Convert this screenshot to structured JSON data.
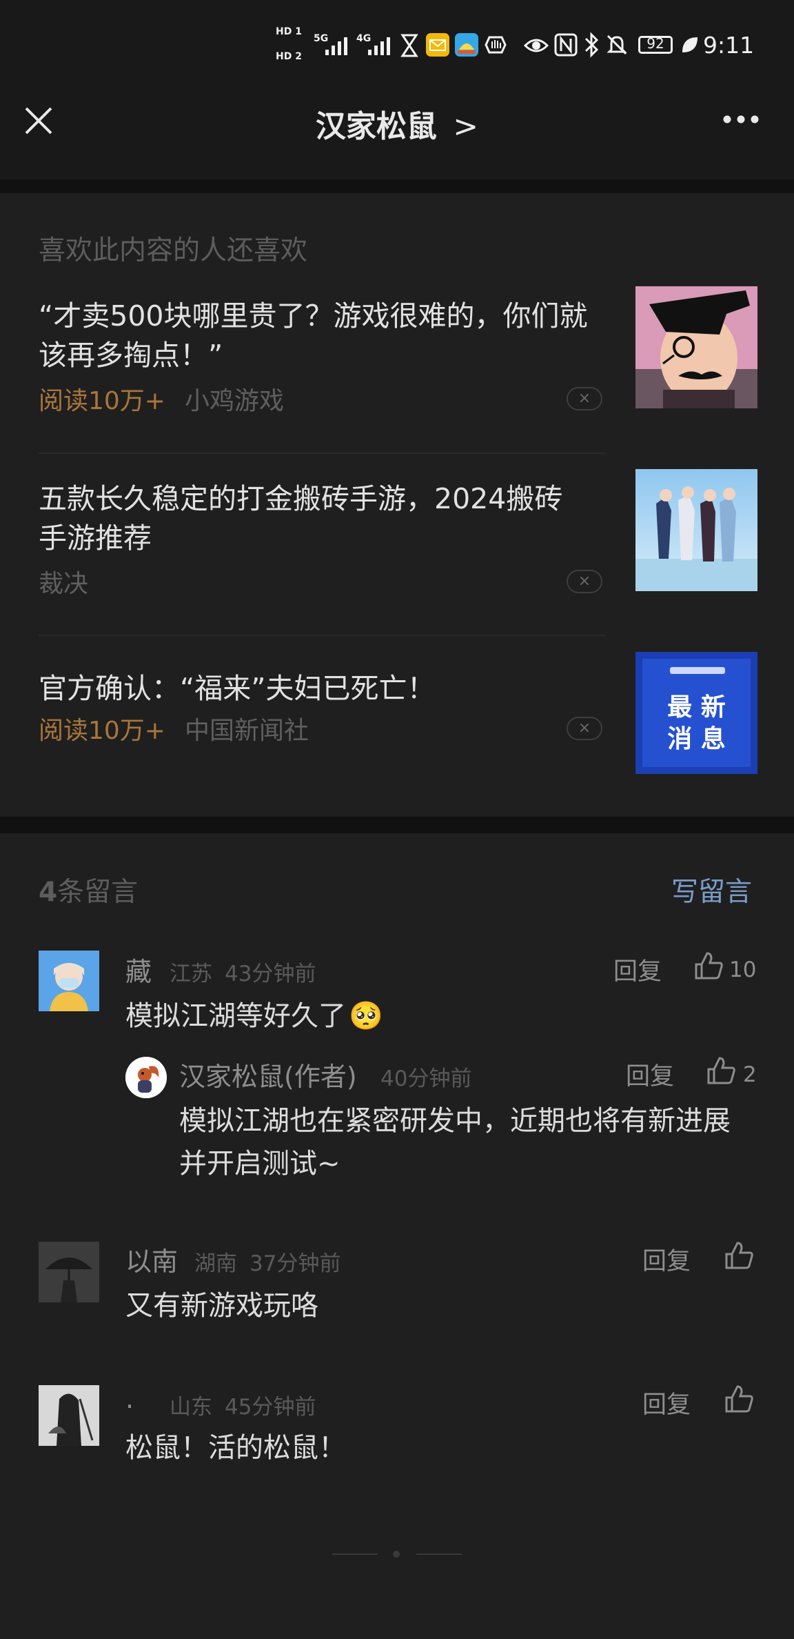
{
  "status_bar": {
    "sim1": "HD 1",
    "sim2": "HD 2",
    "net1": "5G",
    "net2": "4G",
    "battery": "92",
    "time": "9:11"
  },
  "nav": {
    "title": "汉家松鼠",
    "chevron": ">",
    "close_icon": "close-icon",
    "more_icon": "more-icon"
  },
  "recommend": {
    "heading": "喜欢此内容的人还喜欢",
    "items": [
      {
        "title": "“才卖500块哪里贵了？游戏很难的，你们就该再多掏点！”",
        "read": "阅读10万+",
        "source": "小鸡游戏",
        "close": "×"
      },
      {
        "title": "五款长久稳定的打金搬砖手游，2024搬砖手游推荐",
        "read": "",
        "source": "裁决",
        "close": "×"
      },
      {
        "title": "官方确认：“福来”夫妇已死亡！",
        "read": "阅读10万+",
        "source": "中国新闻社",
        "close": "×",
        "thumb_line1": "最 新",
        "thumb_line2": "消 息"
      }
    ]
  },
  "comments": {
    "count_num": "4",
    "count_label": "条留言",
    "write_label": "写留言",
    "items": [
      {
        "name": "藏",
        "location": "江苏",
        "time": "43分钟前",
        "reply_label": "回复",
        "likes": "10",
        "text": "模拟江湖等好久了",
        "emoji": "🥺",
        "author_reply": {
          "name": "汉家松鼠(作者)",
          "time": "40分钟前",
          "reply_label": "回复",
          "likes": "2",
          "text_line1": "模拟江湖也在紧密研发中，近期也将有新进展",
          "text_line2": "并开启测试~"
        }
      },
      {
        "name": "以南",
        "location": "湖南",
        "time": "37分钟前",
        "reply_label": "回复",
        "likes": "",
        "text": "又有新游戏玩咯"
      },
      {
        "name": ".",
        "location": "山东",
        "time": "45分钟前",
        "reply_label": "回复",
        "likes": "",
        "text": "松鼠！活的松鼠！"
      }
    ]
  },
  "colors": {
    "background": "#191919",
    "card": "#1f1f1f",
    "accent_read": "#a9763a",
    "link": "#7a9cc9"
  }
}
